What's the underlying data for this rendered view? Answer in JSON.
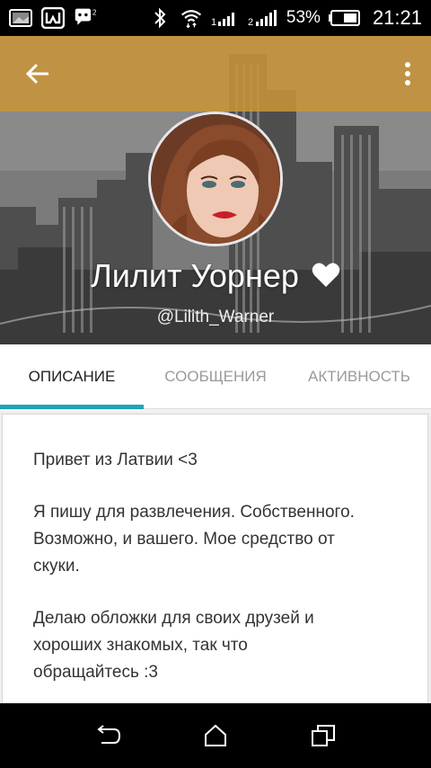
{
  "status_bar": {
    "battery_percent": "53%",
    "time": "21:21",
    "sim1_label": "1",
    "sim2_label": "2",
    "icons": [
      "image-icon",
      "wattpad-icon",
      "messenger-icon",
      "bluetooth-icon",
      "wifi-icon",
      "signal-icon",
      "battery-icon"
    ]
  },
  "app_bar": {
    "back_icon": "arrow-left-icon",
    "menu_icon": "more-vertical-icon",
    "accent_color": "#c7943a"
  },
  "profile": {
    "display_name": "Лилит Уорнер",
    "heart": "❤",
    "username": "@Lilith_Warner"
  },
  "tabs": [
    {
      "label": "ОПИСАНИЕ",
      "active": true
    },
    {
      "label": "СООБЩЕНИЯ",
      "active": false
    },
    {
      "label": "АКТИВНОСТЬ",
      "active": false
    }
  ],
  "tab_indicator_color": "#1fa3b8",
  "description": {
    "paragraphs": [
      "Привет из Латвии <3",
      "Я пишу для развлечения. Собственного.\nВозможно, и вашего. Мое средство от\nскуки.",
      "Делаю обложки для своих друзей и\nхороших знакомых, так что\nобращайтесь :3"
    ]
  },
  "nav_bar": {
    "icons": [
      "back-nav-icon",
      "home-nav-icon",
      "recents-nav-icon"
    ]
  }
}
